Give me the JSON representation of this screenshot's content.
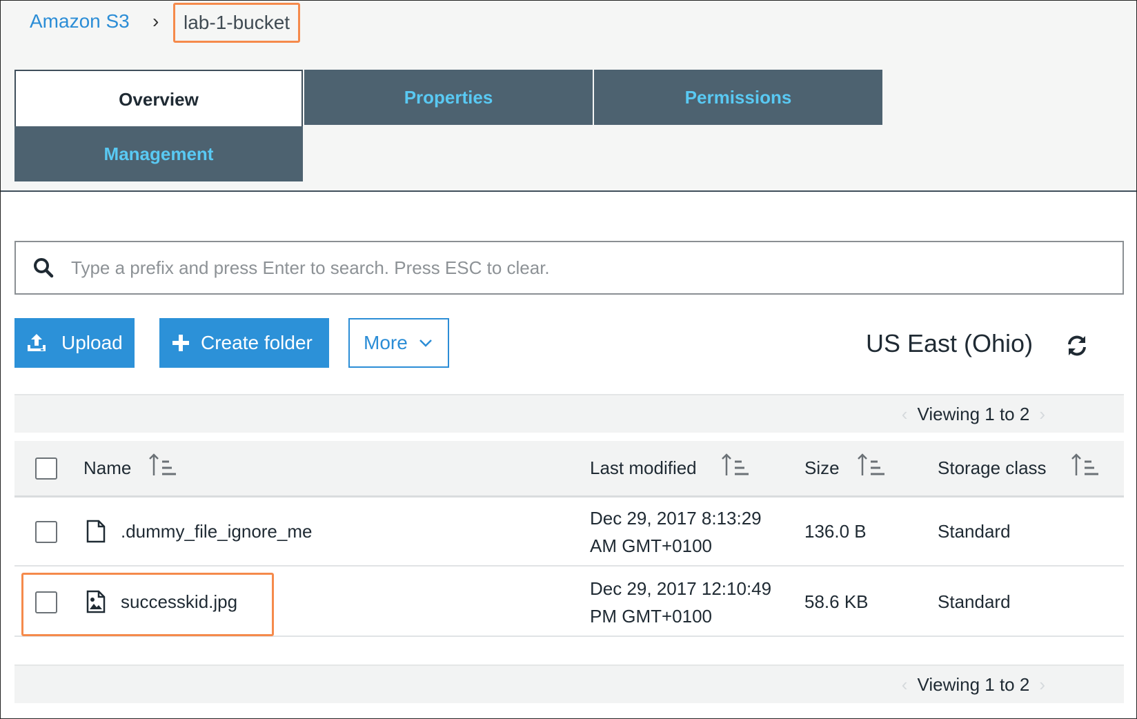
{
  "breadcrumb": {
    "root": "Amazon S3",
    "separator": "›",
    "current": "lab-1-bucket"
  },
  "tabs": [
    {
      "label": "Overview",
      "active": true
    },
    {
      "label": "Properties",
      "active": false
    },
    {
      "label": "Permissions",
      "active": false
    },
    {
      "label": "Management",
      "active": false
    }
  ],
  "search": {
    "placeholder": "Type a prefix and press Enter to search. Press ESC to clear.",
    "value": ""
  },
  "actions": {
    "upload": "Upload",
    "create_folder": "Create folder",
    "more": "More"
  },
  "region": "US East (Ohio)",
  "pager": {
    "top": "Viewing 1 to 2",
    "bottom": "Viewing 1 to 2"
  },
  "table": {
    "columns": [
      "Name",
      "Last modified",
      "Size",
      "Storage class"
    ],
    "rows": [
      {
        "name": ".dummy_file_ignore_me",
        "icon": "document-icon",
        "modified_line1": "Dec 29, 2017 8:13:29",
        "modified_line2": "AM GMT+0100",
        "size": "136.0 B",
        "storage_class": "Standard"
      },
      {
        "name": "successkid.jpg",
        "icon": "image-file-icon",
        "modified_line1": "Dec 29, 2017 12:10:49",
        "modified_line2": "PM GMT+0100",
        "size": "58.6 KB",
        "storage_class": "Standard"
      }
    ]
  },
  "colors": {
    "link": "#2b8dd6",
    "tab_bg": "#4d6270",
    "tab_text": "#59c9f3",
    "primary_button": "#2c91d8",
    "highlight": "#f58a4b"
  }
}
